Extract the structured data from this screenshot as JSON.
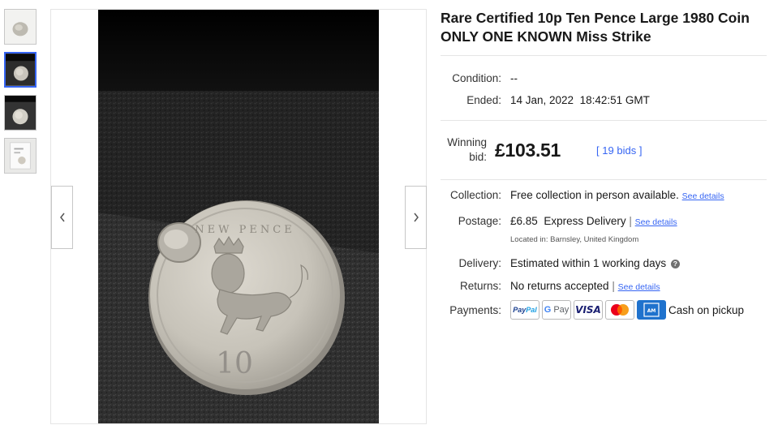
{
  "thumbnails": [
    {
      "alt": "thumb-1"
    },
    {
      "alt": "thumb-2"
    },
    {
      "alt": "thumb-3"
    },
    {
      "alt": "thumb-4"
    }
  ],
  "coin": {
    "legend_top": "NEW PENCE",
    "denomination": "10"
  },
  "listing": {
    "title": "Rare Certified 10p Ten Pence Large 1980 Coin ONLY ONE KNOWN Miss Strike",
    "condition_label": "Condition:",
    "condition_value": "--",
    "ended_label": "Ended:",
    "ended_date": "14 Jan, 2022",
    "ended_time": "18:42:51 GMT",
    "winning_bid_label_1": "Winning",
    "winning_bid_label_2": "bid:",
    "winning_bid_price": "£103.51",
    "bids_open": "[",
    "bids_text": "19 bids",
    "bids_close": "]"
  },
  "shipping": {
    "collection_label": "Collection:",
    "collection_value": "Free collection in person available.",
    "collection_link": "See details",
    "postage_label": "Postage:",
    "postage_price": "£6.85",
    "postage_service": "Express Delivery",
    "postage_link": "See details",
    "located_in": "Located in:  Barnsley, United Kingdom",
    "delivery_label": "Delivery:",
    "delivery_value": "Estimated within 1 working days",
    "returns_label": "Returns:",
    "returns_value": "No returns accepted",
    "returns_link": "See details",
    "payments_label": "Payments:",
    "payment_methods": [
      "PayPal",
      "G Pay",
      "VISA",
      "Mastercard",
      "American Express"
    ],
    "cash_on_pickup": "Cash on pickup"
  },
  "colors": {
    "link": "#3665f3",
    "active_thumb_border": "#3665f3",
    "divider": "#e5e5e5"
  },
  "icons": {
    "prev": "chevron-left-icon",
    "next": "chevron-right-icon",
    "help": "question-circle-icon"
  }
}
